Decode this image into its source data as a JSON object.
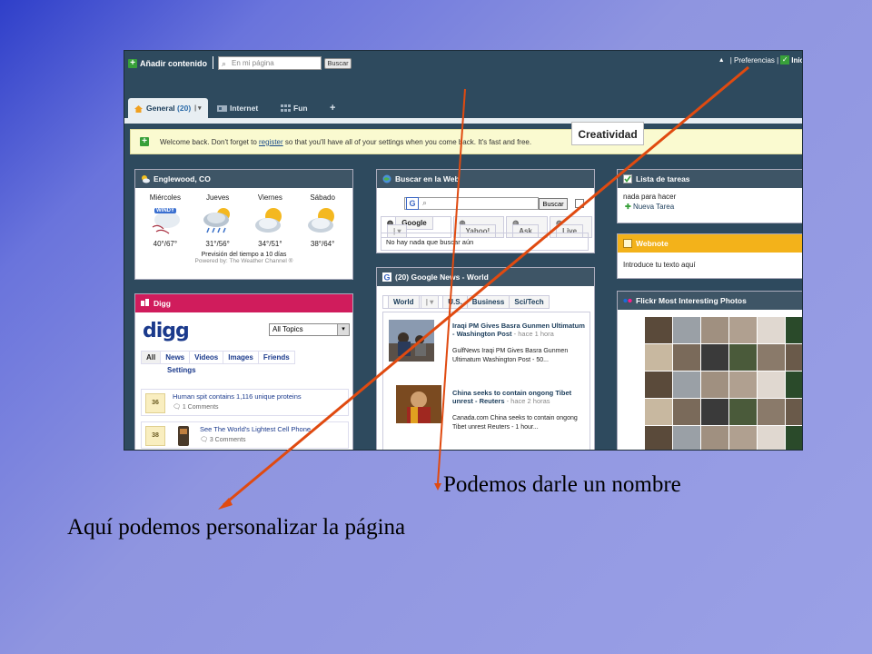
{
  "topbar": {
    "add_label": "Añadir contenido",
    "search_placeholder": "En mi página",
    "search_button": "Buscar",
    "right_prefs": "| Preferencias |",
    "right_inicio": "Inic"
  },
  "callout": "Creatividad",
  "tabs": [
    {
      "label": "General",
      "count": "(20)",
      "active": true
    },
    {
      "label": "Internet"
    },
    {
      "label": "Fun"
    }
  ],
  "add_tab_icon": "+",
  "welcome": {
    "before": "Welcome back. Don't forget to ",
    "link": "register",
    "after": " so that you'll have all of your settings when you come back. It's fast and free."
  },
  "weather": {
    "title": "Englewood, CO",
    "days": [
      {
        "name": "Miércoles",
        "temp": "40°/67°",
        "icon": "windy-icon",
        "badge": "WINDY"
      },
      {
        "name": "Jueves",
        "temp": "31°/56°",
        "icon": "rain-icon"
      },
      {
        "name": "Viernes",
        "temp": "34°/51°",
        "icon": "partly-cloudy-icon"
      },
      {
        "name": "Sábado",
        "temp": "38°/64°",
        "icon": "partly-cloudy-icon"
      }
    ],
    "forecast_link": "Previsión del tiempo a 10 días",
    "powered": "Powered by: The Weather Channel ®"
  },
  "search_widget": {
    "title": "Buscar en la Web",
    "button": "Buscar",
    "tabs": [
      "Google",
      "Yahoo!",
      "Ask",
      "Live"
    ],
    "note": "No hay nada que buscar aún"
  },
  "tasks": {
    "title": "Lista de tareas",
    "line": "nada para hacer",
    "new_task": "Nueva Tarea"
  },
  "webnote": {
    "title": "Webnote",
    "text": "Introduce tu texto aquí"
  },
  "digg": {
    "title": "Digg",
    "logo": "digg",
    "select": "All Topics",
    "tabs": [
      "All",
      "News",
      "Videos",
      "Images",
      "Friends",
      "Settings"
    ],
    "stories": [
      {
        "count": "36",
        "title": "Human spit contains 1,116 unique proteins",
        "comments": "1 Comments"
      },
      {
        "count": "38",
        "title": "See The World's Lightest Cell Phone",
        "comments": "3 Comments"
      }
    ]
  },
  "news": {
    "title": "(20) Google News - World",
    "tabs": [
      "World",
      "U.S.",
      "Business",
      "Sci/Tech"
    ],
    "items": [
      {
        "title": "Iraqi PM Gives Basra Gunmen Ultimatum - Washington Post",
        "age": " - hace 1 hora",
        "body": "GulfNews Iraqi PM Gives Basra Gunmen Ultimatum Washington Post - 50..."
      },
      {
        "title": "China seeks to contain ongong Tibet unrest - Reuters",
        "age": " - hace 2 horas",
        "body": "Canada.com China seeks to contain ongong Tibet unrest Reuters - 1 hour..."
      }
    ]
  },
  "flickr": {
    "title": "Flickr Most Interesting Photos"
  },
  "captions": {
    "name_caption": "Podemos darle un nombre",
    "customize_caption": "Aquí podemos personalizar la página"
  },
  "colors": {
    "shell": "#2e4a5e",
    "digg_header": "#d01c5c",
    "webnote_header": "#f3b21a",
    "arrow": "#e04a10",
    "slide_bg": "#9aa0e6"
  }
}
